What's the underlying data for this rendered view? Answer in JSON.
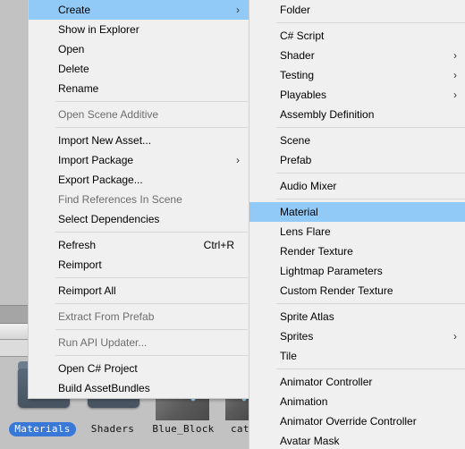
{
  "context_menu": {
    "items": [
      {
        "type": "item",
        "label": "Create",
        "submenu": true,
        "highlighted": true
      },
      {
        "type": "item",
        "label": "Show in Explorer"
      },
      {
        "type": "item",
        "label": "Open"
      },
      {
        "type": "item",
        "label": "Delete"
      },
      {
        "type": "item",
        "label": "Rename"
      },
      {
        "type": "separator"
      },
      {
        "type": "item",
        "label": "Open Scene Additive",
        "disabled": true
      },
      {
        "type": "separator"
      },
      {
        "type": "item",
        "label": "Import New Asset..."
      },
      {
        "type": "item",
        "label": "Import Package",
        "submenu": true
      },
      {
        "type": "item",
        "label": "Export Package..."
      },
      {
        "type": "item",
        "label": "Find References In Scene",
        "disabled": true
      },
      {
        "type": "item",
        "label": "Select Dependencies"
      },
      {
        "type": "separator"
      },
      {
        "type": "item",
        "label": "Refresh",
        "shortcut": "Ctrl+R"
      },
      {
        "type": "item",
        "label": "Reimport"
      },
      {
        "type": "separator"
      },
      {
        "type": "item",
        "label": "Reimport All"
      },
      {
        "type": "separator"
      },
      {
        "type": "item",
        "label": "Extract From Prefab",
        "disabled": true
      },
      {
        "type": "separator"
      },
      {
        "type": "item",
        "label": "Run API Updater...",
        "disabled": true
      },
      {
        "type": "separator"
      },
      {
        "type": "item",
        "label": "Open C# Project"
      },
      {
        "type": "item",
        "label": "Build AssetBundles"
      }
    ]
  },
  "create_submenu": {
    "items": [
      {
        "type": "item",
        "label": "Folder"
      },
      {
        "type": "separator"
      },
      {
        "type": "item",
        "label": "C# Script"
      },
      {
        "type": "item",
        "label": "Shader",
        "submenu": true
      },
      {
        "type": "item",
        "label": "Testing",
        "submenu": true
      },
      {
        "type": "item",
        "label": "Playables",
        "submenu": true
      },
      {
        "type": "item",
        "label": "Assembly Definition"
      },
      {
        "type": "separator"
      },
      {
        "type": "item",
        "label": "Scene"
      },
      {
        "type": "item",
        "label": "Prefab"
      },
      {
        "type": "separator"
      },
      {
        "type": "item",
        "label": "Audio Mixer"
      },
      {
        "type": "separator"
      },
      {
        "type": "item",
        "label": "Material",
        "highlighted": true
      },
      {
        "type": "item",
        "label": "Lens Flare"
      },
      {
        "type": "item",
        "label": "Render Texture"
      },
      {
        "type": "item",
        "label": "Lightmap Parameters"
      },
      {
        "type": "item",
        "label": "Custom Render Texture"
      },
      {
        "type": "separator"
      },
      {
        "type": "item",
        "label": "Sprite Atlas"
      },
      {
        "type": "item",
        "label": "Sprites",
        "submenu": true
      },
      {
        "type": "item",
        "label": "Tile"
      },
      {
        "type": "separator"
      },
      {
        "type": "item",
        "label": "Animator Controller"
      },
      {
        "type": "item",
        "label": "Animation"
      },
      {
        "type": "item",
        "label": "Animator Override Controller"
      },
      {
        "type": "item",
        "label": "Avatar Mask"
      }
    ]
  },
  "assets": [
    {
      "name": "Materials",
      "kind": "folder",
      "selected": true
    },
    {
      "name": "Shaders",
      "kind": "folder"
    },
    {
      "name": "Blue_Block",
      "kind": "texture"
    },
    {
      "name": "cat",
      "kind": "texture"
    }
  ],
  "icons": {
    "submenu_arrow": "›"
  },
  "colors": {
    "highlight": "#91c9f7",
    "selection": "#3a78d8",
    "menu_bg": "#f0f0f0",
    "disabled_text": "#6d6d6d"
  }
}
